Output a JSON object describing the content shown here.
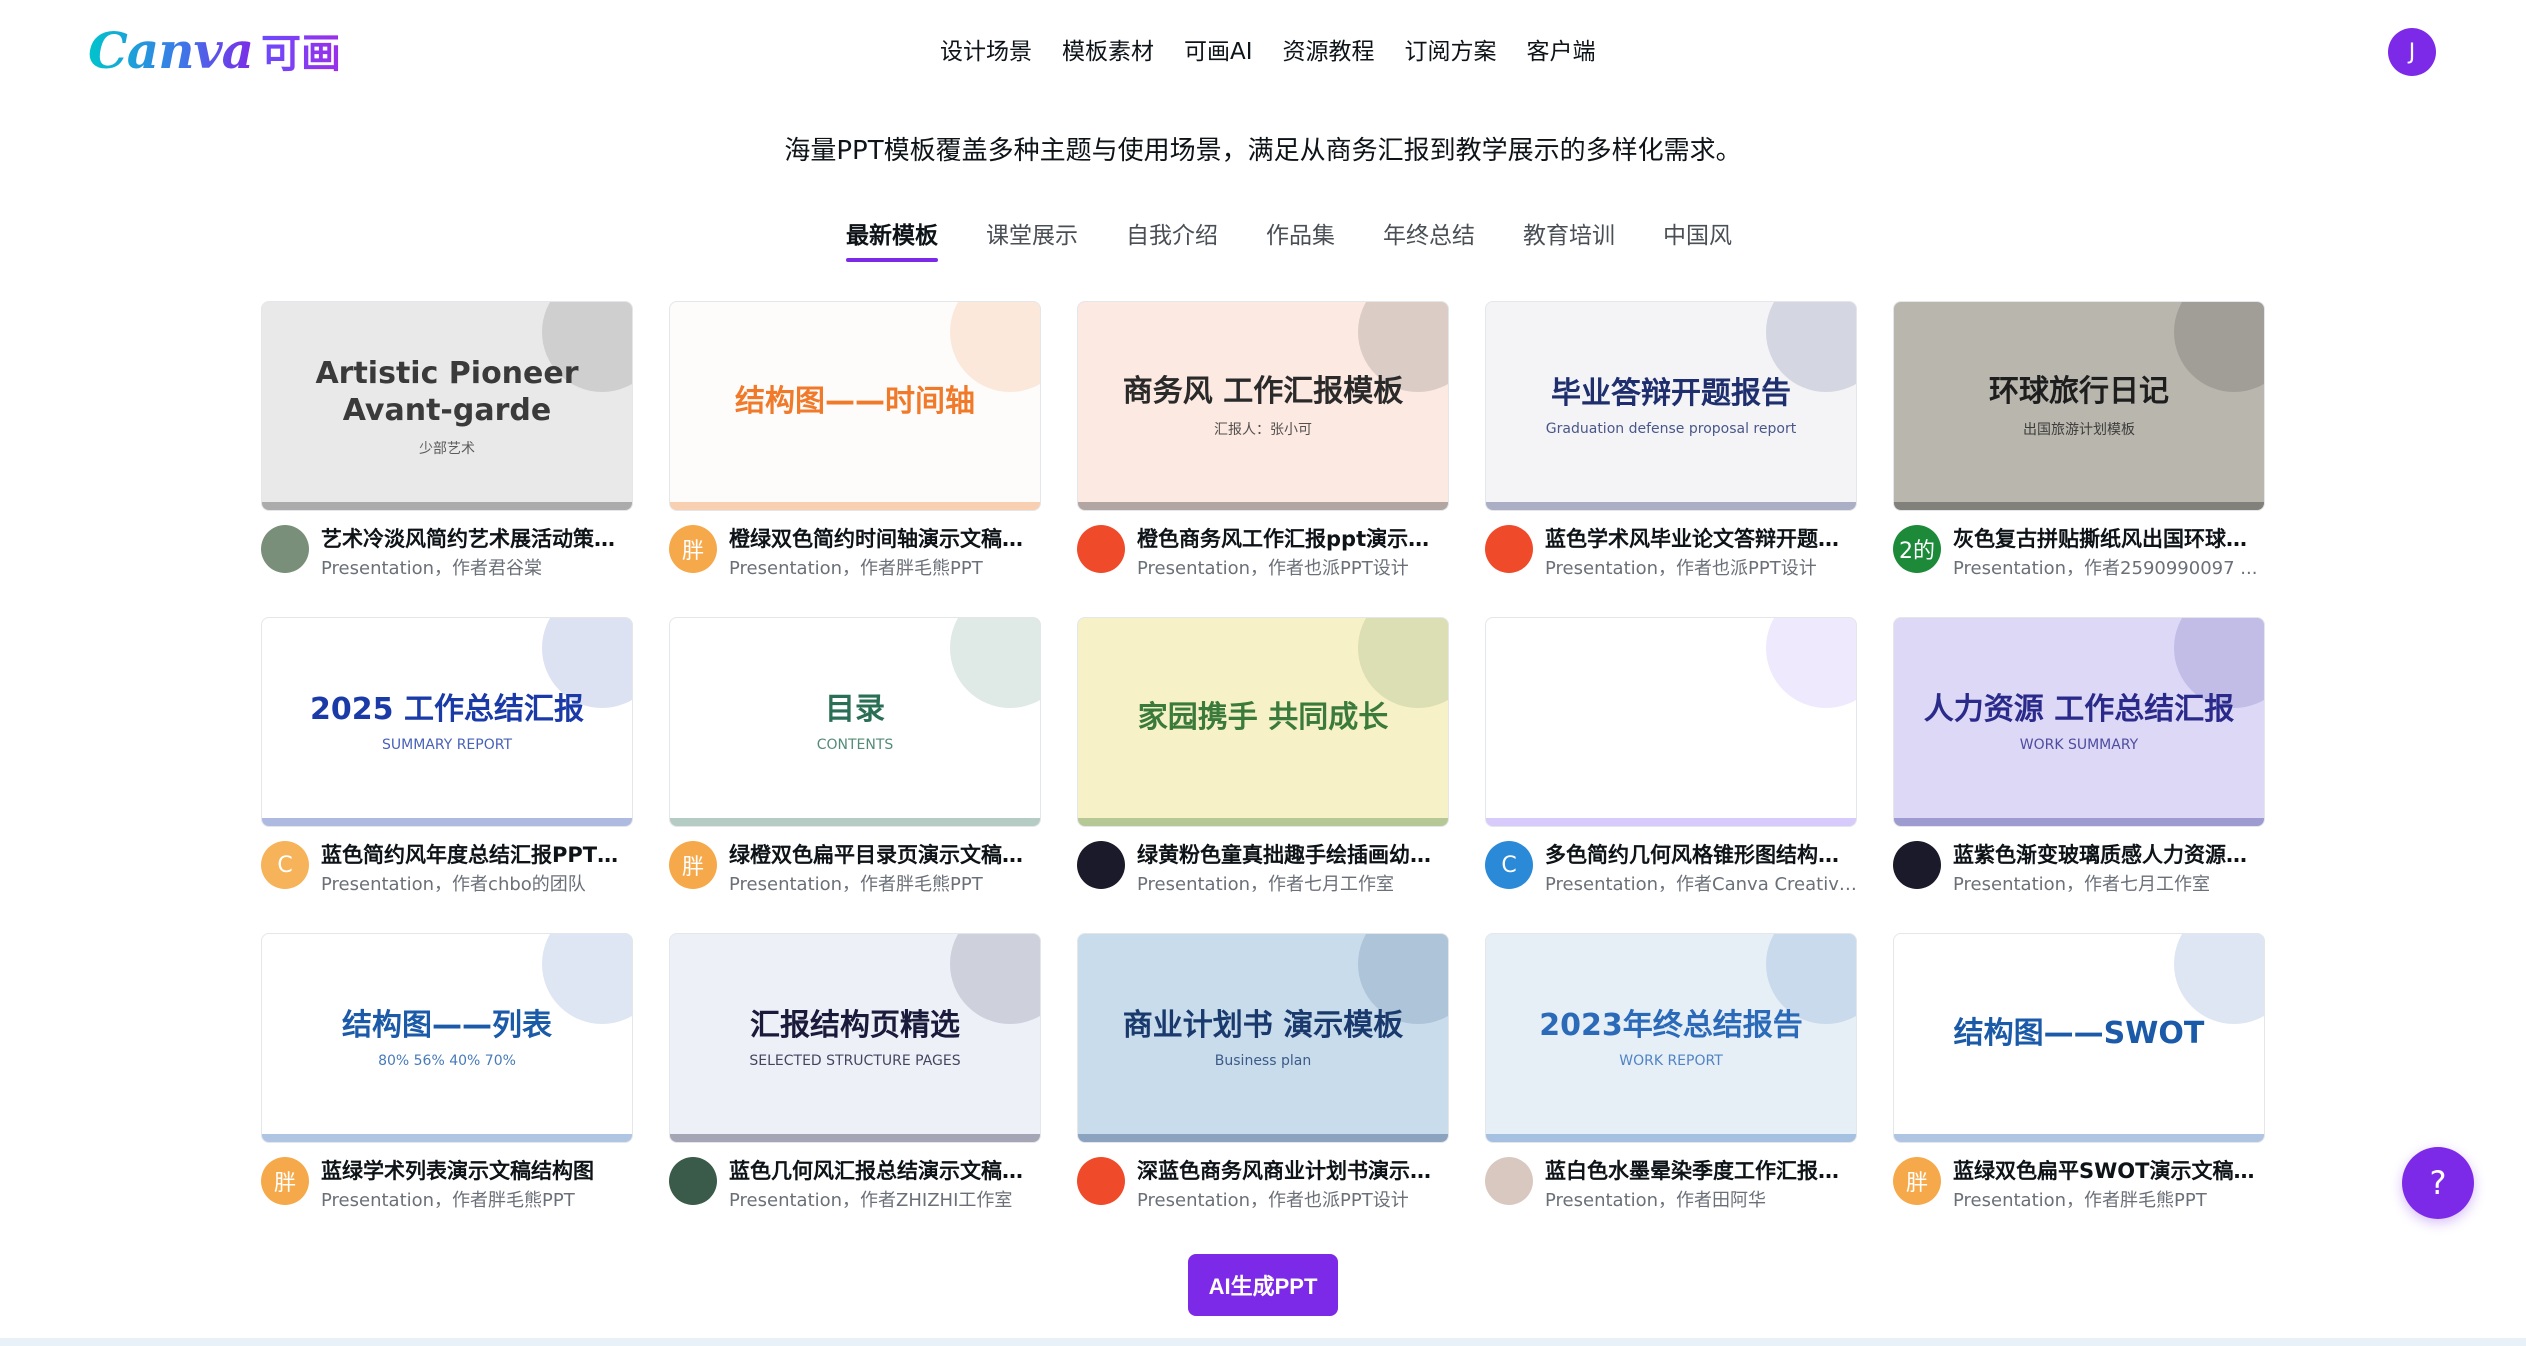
{
  "header": {
    "logo_text": "Canva",
    "logo_cn": "可画",
    "nav": [
      "设计场景",
      "模板素材",
      "可画AI",
      "资源教程",
      "订阅方案",
      "客户端"
    ],
    "avatar_letter": "J"
  },
  "subtitle": "海量PPT模板覆盖多种主题与使用场景，满足从商务汇报到教学展示的多样化需求。",
  "tabs": [
    "最新模板",
    "课堂展示",
    "自我介绍",
    "作品集",
    "年终总结",
    "教育培训",
    "中国风"
  ],
  "active_tab": "最新模板",
  "cards": [
    {
      "title": "艺术冷淡风简约艺术展活动策划...",
      "subtitle": "Presentation，作者君谷棠",
      "thumb_title": "Artistic Pioneer  Avant-garde",
      "thumb_sub": "少部艺术",
      "thumb_bg": "#e9e9ea",
      "thumb_color": "#3a3a3a",
      "avatar_text": "",
      "avatar_bg": "#7a8f7a"
    },
    {
      "title": "橙绿双色简约时间轴演示文稿结...",
      "subtitle": "Presentation，作者胖毛熊PPT",
      "thumb_title": "结构图——时间轴",
      "thumb_sub": "",
      "thumb_bg": "#fdfcfa",
      "thumb_color": "#f07a2a",
      "avatar_text": "胖",
      "avatar_bg": "#f6a94a"
    },
    {
      "title": "橙色商务风工作汇报ppt演示文稿",
      "subtitle": "Presentation，作者也派PPT设计",
      "thumb_title": "商务风 工作汇报模板",
      "thumb_sub": "汇报人：张小可",
      "thumb_bg": "#fbe9e2",
      "thumb_color": "#2a2a2a",
      "avatar_text": "",
      "avatar_bg": "#ef4b2a"
    },
    {
      "title": "蓝色学术风毕业论文答辩开题报...",
      "subtitle": "Presentation，作者也派PPT设计",
      "thumb_title": "毕业答辩开题报告",
      "thumb_sub": "Graduation defense proposal report",
      "thumb_bg": "#f4f4f6",
      "thumb_color": "#1f2f6e",
      "avatar_text": "",
      "avatar_bg": "#ef4b2a"
    },
    {
      "title": "灰色复古拼贴撕纸风出国环球旅...",
      "subtitle": "Presentation，作者2590990097 ...",
      "thumb_title": "环球旅行日记",
      "thumb_sub": "出国旅游计划模板",
      "thumb_bg": "#b9b6ae",
      "thumb_color": "#1e1e1e",
      "avatar_text": "2的",
      "avatar_bg": "#1d8a3a"
    },
    {
      "title": "蓝色简约风年度总结汇报PPT演...",
      "subtitle": "Presentation，作者chbo的团队",
      "thumb_title": "2025 工作总结汇报",
      "thumb_sub": "SUMMARY REPORT",
      "thumb_bg": "#ffffff",
      "thumb_color": "#1a3aa8",
      "avatar_text": "C",
      "avatar_bg": "#f6b35a"
    },
    {
      "title": "绿橙双色扁平目录页演示文稿结...",
      "subtitle": "Presentation，作者胖毛熊PPT",
      "thumb_title": "目录",
      "thumb_sub": "CONTENTS",
      "thumb_bg": "#ffffff",
      "thumb_color": "#2a6e55",
      "avatar_text": "胖",
      "avatar_bg": "#f6a94a"
    },
    {
      "title": "绿黄粉色童真拙趣手绘插画幼儿...",
      "subtitle": "Presentation，作者七月工作室",
      "thumb_title": "家园携手 共同成长",
      "thumb_sub": "",
      "thumb_bg": "#f7f1c8",
      "thumb_color": "#3a7a3a",
      "avatar_text": "",
      "avatar_bg": "#1a1a2a"
    },
    {
      "title": "多色简约几何风格锥形图结构图...",
      "subtitle": "Presentation，作者Canva Creative...",
      "thumb_title": "",
      "thumb_sub": "",
      "thumb_bg": "#ffffff",
      "thumb_color": "#8a6af0",
      "avatar_text": "C",
      "avatar_bg": "#2a8ad8"
    },
    {
      "title": "蓝紫色渐变玻璃质感人力资源工...",
      "subtitle": "Presentation，作者七月工作室",
      "thumb_title": "人力资源 工作总结汇报",
      "thumb_sub": "WORK SUMMARY",
      "thumb_bg": "#dcd8f6",
      "thumb_color": "#2a2a8a",
      "avatar_text": "",
      "avatar_bg": "#1a1a2a"
    },
    {
      "title": "蓝绿学术列表演示文稿结构图",
      "subtitle": "Presentation，作者胖毛熊PPT",
      "thumb_title": "结构图——列表",
      "thumb_sub": "80%  56%  40%  70%",
      "thumb_bg": "#ffffff",
      "thumb_color": "#1a5aa8",
      "avatar_text": "胖",
      "avatar_bg": "#f6a94a"
    },
    {
      "title": "蓝色几何风汇报总结演示文稿结...",
      "subtitle": "Presentation，作者ZHIZHI工作室",
      "thumb_title": "汇报结构页精选",
      "thumb_sub": "SELECTED STRUCTURE PAGES",
      "thumb_bg": "#eef0f8",
      "thumb_color": "#1a1a3a",
      "avatar_text": "",
      "avatar_bg": "#3a5a4a"
    },
    {
      "title": "深蓝色商务风商业计划书演示文...",
      "subtitle": "Presentation，作者也派PPT设计",
      "thumb_title": "商业计划书 演示模板",
      "thumb_sub": "Business plan",
      "thumb_bg": "#c8dcec",
      "thumb_color": "#1a3a6e",
      "avatar_text": "",
      "avatar_bg": "#ef4b2a"
    },
    {
      "title": "蓝白色水墨晕染季度工作汇报年...",
      "subtitle": "Presentation，作者田阿华",
      "thumb_title": "2023年终总结报告",
      "thumb_sub": "WORK REPORT",
      "thumb_bg": "#e6eef6",
      "thumb_color": "#2a6ab8",
      "avatar_text": "",
      "avatar_bg": "#d8c8c0"
    },
    {
      "title": "蓝绿双色扁平SWOT演示文稿结...",
      "subtitle": "Presentation，作者胖毛熊PPT",
      "thumb_title": "结构图——SWOT",
      "thumb_sub": "",
      "thumb_bg": "#ffffff",
      "thumb_color": "#1a5aa8",
      "avatar_text": "胖",
      "avatar_bg": "#f6a94a"
    }
  ],
  "ai_button": "AI生成PPT",
  "help_button": "?",
  "colors": {
    "accent": "#7d2ae8",
    "text": "#0e1318",
    "muted": "#6b7078"
  }
}
